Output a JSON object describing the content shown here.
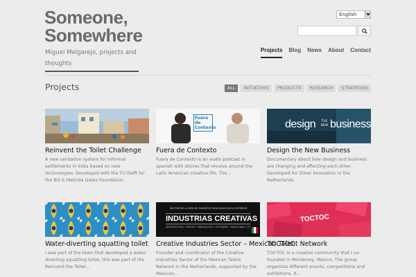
{
  "header": {
    "title_line1": "Someone,",
    "title_line2": "Somewhere",
    "tagline": "Miguel Melgarejo, projects and thoughts",
    "language": "English",
    "search_placeholder": ""
  },
  "nav": {
    "items": [
      {
        "label": "Projects",
        "active": true
      },
      {
        "label": "Blog"
      },
      {
        "label": "News"
      },
      {
        "label": "About"
      },
      {
        "label": "Contact"
      }
    ]
  },
  "section": {
    "title": "Projects",
    "filters": [
      "ALL",
      "INITIATIVES",
      "PRODUCTS",
      "RESEARCH",
      "STRATEGIES"
    ]
  },
  "projects": [
    {
      "title": "Reinvent the Toilet Challenge",
      "description": "A new sanitation system for informal settlements in India based on new technologies. Developed with the TU Delft for the Bill & Melinda Gates Foundation."
    },
    {
      "title": "Fuera de Contexto",
      "description": "Fuera de Contexto is an audio podcast in spanish with stories that revolve around the Latin American creative life. The...",
      "thumb_text": "Fuera de Contexto"
    },
    {
      "title": "Design the New Business",
      "description": "Documentary about how design and business are changing and affecting each other. Developed for Zilver Innovation in the Netherlands.",
      "thumb_text_left": "design",
      "thumb_text_small": "THE NEW",
      "thumb_text_right": "business"
    },
    {
      "title": "Water-diverting squatting toilet",
      "description": "I was part of the team that developed a water-diverting squatting toilet, this was part of the Reinvent the Toilet..."
    },
    {
      "title": "Creative Industries Sector – Mexican Talent Network",
      "description": "Founder and coordinator of the Creative Industries Sector of the Mexican Talent Network in the Netherlands, supported by the Mexican...",
      "thumb_text_top": "SECTOR DE LA RED DE TALENTOS MEXICANOS EN EL EXTERIOR",
      "thumb_text": "INDUSTRIAS CREATIVAS",
      "thumb_text_bottom": "ARQUITECTURA • DISEÑO • INNOVACIÓN • SOFTWARE • PUBLICIDAD • ETC."
    },
    {
      "title": "TOCTOC",
      "description": "TOCTOC is a creative community that I co-founded in Monterrey, Mexico. The group organizes different events, competitions and exhibitions. It...",
      "thumb_text": "TOCTOC"
    }
  ]
}
